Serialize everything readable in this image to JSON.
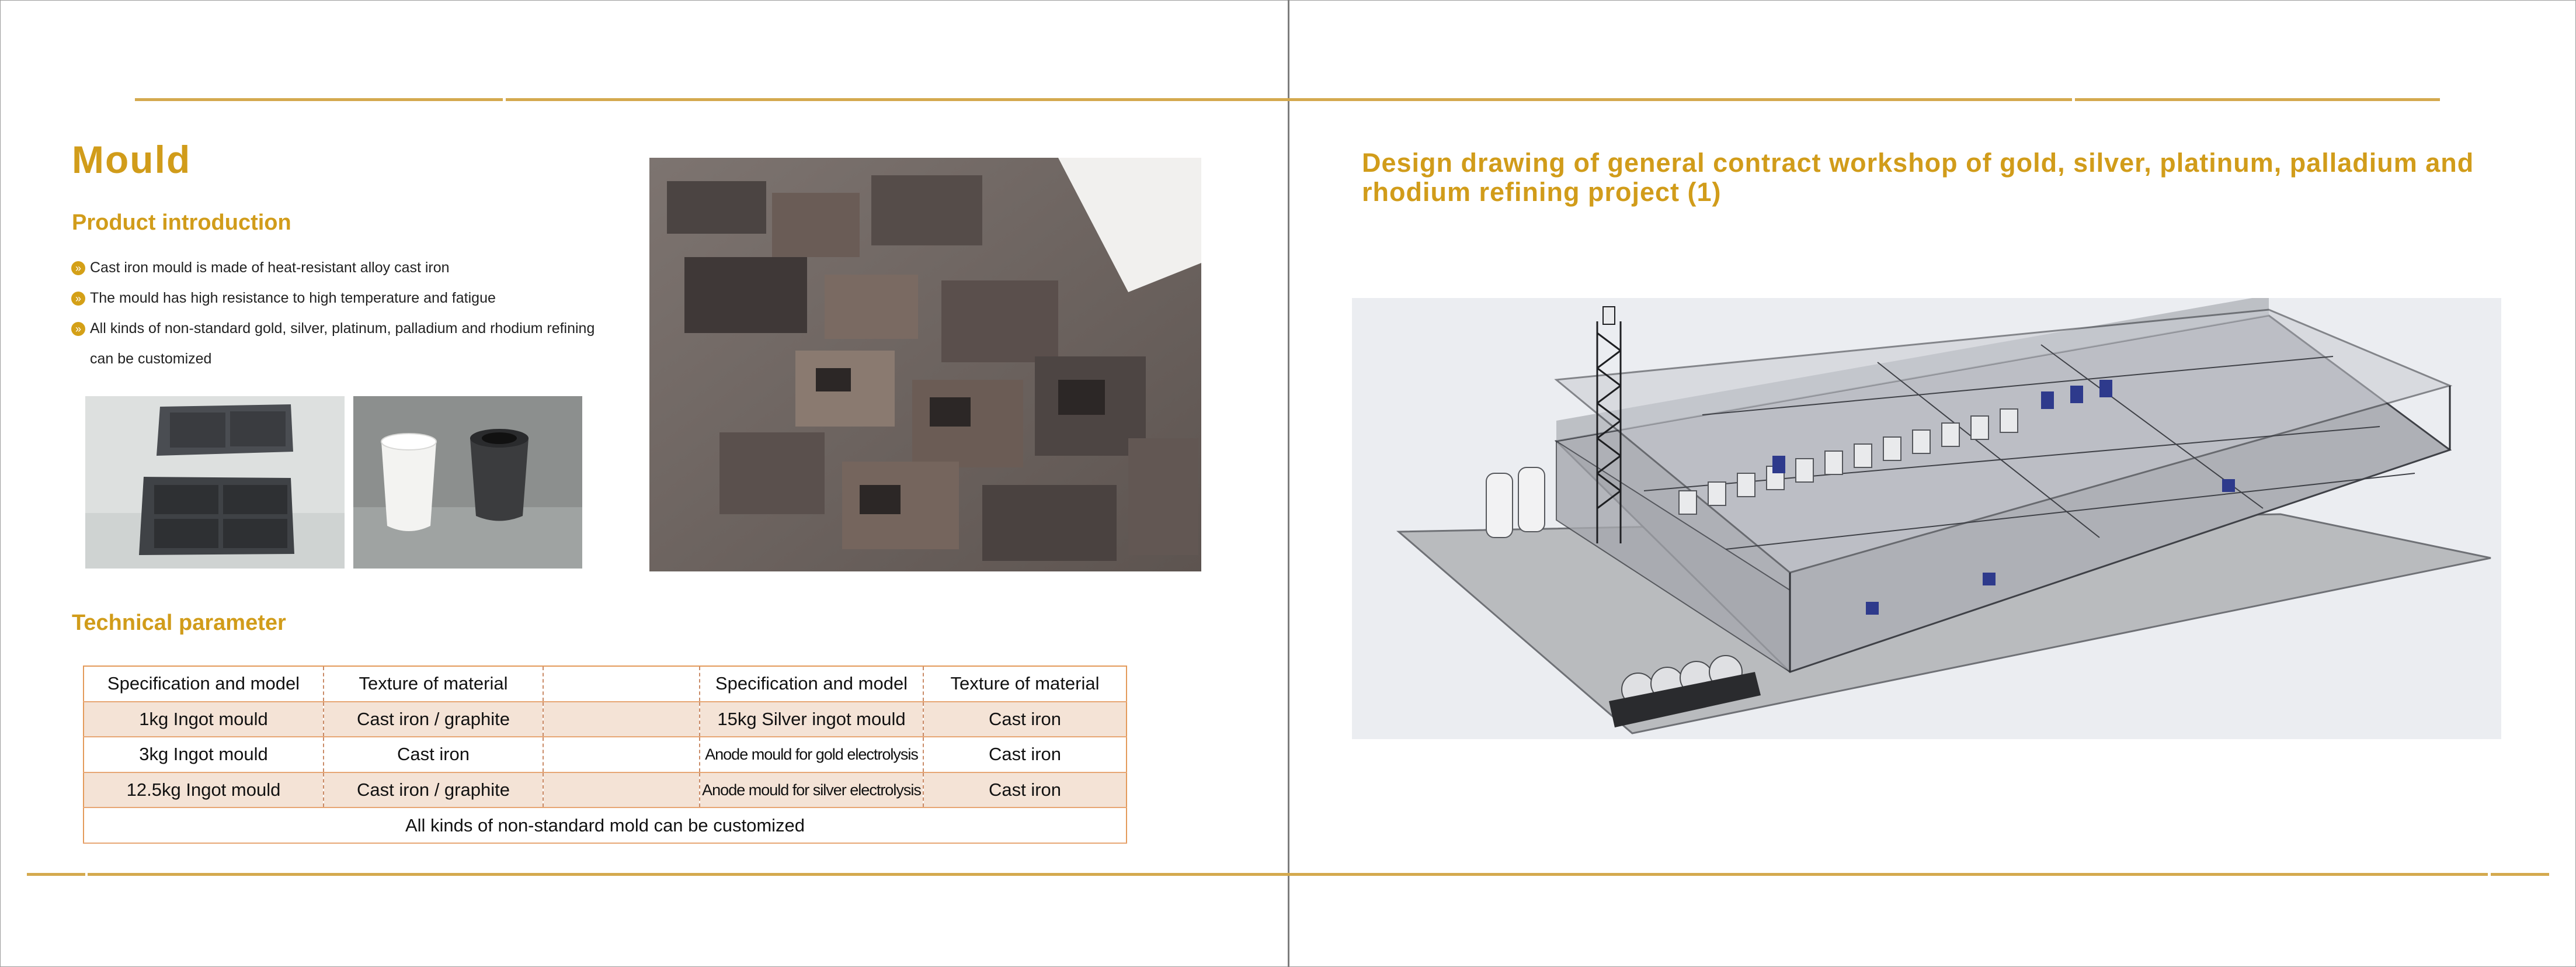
{
  "left_page": {
    "title": "Mould",
    "product_intro": {
      "heading": "Product introduction",
      "bullets": [
        "Cast iron mould is made of heat-resistant alloy cast iron",
        "The mould has high resistance to high temperature and fatigue",
        "All kinds of non-standard gold, silver, platinum, palladium and rhodium refining can be customized"
      ]
    },
    "technical_parameter": {
      "heading": "Technical parameter",
      "headers": [
        "Specification and model",
        "Texture of material",
        "",
        "Specification and model",
        "Texture of material"
      ],
      "rows": [
        [
          "1kg Ingot mould",
          "Cast iron / graphite",
          "",
          "15kg Silver ingot mould",
          "Cast iron"
        ],
        [
          "3kg Ingot mould",
          "Cast iron",
          "",
          "Anode mould for gold electrolysis",
          "Cast iron"
        ],
        [
          "12.5kg Ingot mould",
          "Cast iron / graphite",
          "",
          "Anode mould for silver electrolysis",
          "Cast iron"
        ]
      ],
      "footer": "All kinds of non-standard mold can be customized"
    }
  },
  "right_page": {
    "title": "Design drawing of general contract workshop of gold, silver, platinum, palladium and rhodium refining project (1)"
  },
  "colors": {
    "gold": "#d19c1a",
    "rule": "#d4a94e",
    "table_border": "#e39a5a",
    "row_shade": "#f4e3d6"
  },
  "icons": [
    "bullet-arrow-icon"
  ]
}
